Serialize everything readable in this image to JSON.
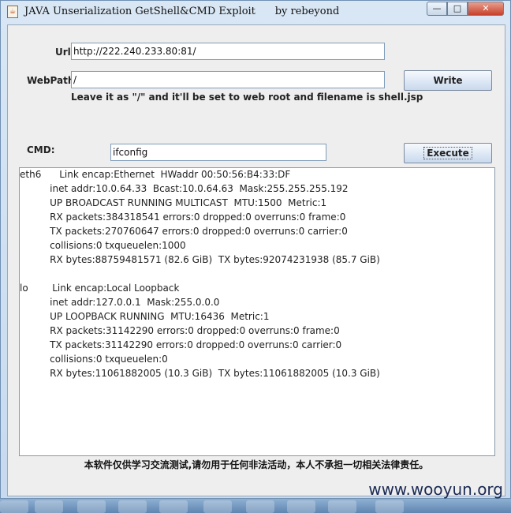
{
  "window": {
    "title": "JAVA Unserialization GetShell&CMD Exploit      by rebeyond",
    "controls": {
      "minimize": "—",
      "maximize": "□",
      "close": "✕"
    }
  },
  "form": {
    "url_label": "Url:",
    "url_value": "http://222.240.233.80:81/",
    "webpath_label": "WebPath:",
    "webpath_value": "/",
    "write_button": "Write",
    "hint": "Leave it as \"/\" and it'll be set to web root and filename is shell.jsp",
    "cmd_label": "CMD:",
    "cmd_value": "ifconfig",
    "execute_button": "Execute"
  },
  "output": {
    "lines": [
      "eth6      Link encap:Ethernet  HWaddr 00:50:56:B4:33:DF",
      "          inet addr:10.0.64.33  Bcast:10.0.64.63  Mask:255.255.255.192",
      "          UP BROADCAST RUNNING MULTICAST  MTU:1500  Metric:1",
      "          RX packets:384318541 errors:0 dropped:0 overruns:0 frame:0",
      "          TX packets:270760647 errors:0 dropped:0 overruns:0 carrier:0",
      "          collisions:0 txqueuelen:1000",
      "          RX bytes:88759481571 (82.6 GiB)  TX bytes:92074231938 (85.7 GiB)",
      "",
      "lo        Link encap:Local Loopback",
      "          inet addr:127.0.0.1  Mask:255.0.0.0",
      "          UP LOOPBACK RUNNING  MTU:16436  Metric:1",
      "          RX packets:31142290 errors:0 dropped:0 overruns:0 frame:0",
      "          TX packets:31142290 errors:0 dropped:0 overruns:0 carrier:0",
      "          collisions:0 txqueuelen:0",
      "          RX bytes:11061882005 (10.3 GiB)  TX bytes:11061882005 (10.3 GiB)"
    ]
  },
  "footer": "本软件仅供学习交流测试,请勿用于任何非法活动，本人不承担一切相关法律责任。",
  "watermark": "www.wooyun.org"
}
